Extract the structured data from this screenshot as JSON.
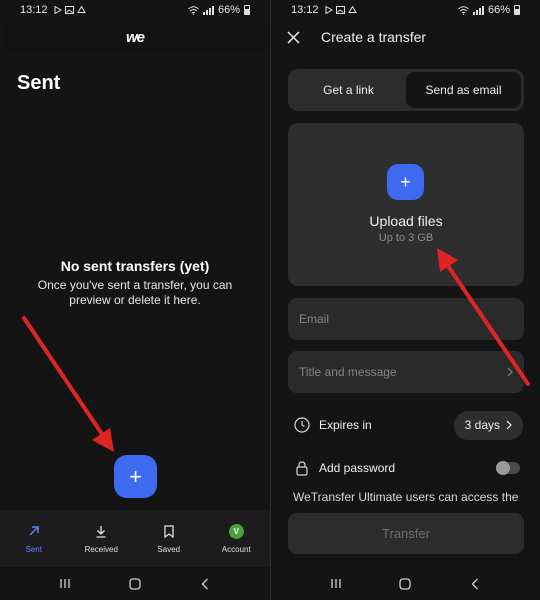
{
  "left": {
    "status": {
      "time": "13:12",
      "battery": "66%"
    },
    "logo": "we",
    "page_title": "Sent",
    "empty_title": "No sent transfers (yet)",
    "empty_desc": "Once you've sent a transfer, you can preview or delete it here.",
    "fab_label": "+",
    "nav": {
      "items": [
        {
          "label": "Sent",
          "icon": "send-arrow-icon"
        },
        {
          "label": "Received",
          "icon": "download-icon"
        },
        {
          "label": "Saved",
          "icon": "bookmark-icon"
        },
        {
          "label": "Account",
          "icon": "avatar"
        }
      ],
      "avatar_letter": "V",
      "active_color": "#5b86ff"
    }
  },
  "right": {
    "status": {
      "time": "13:12",
      "battery": "66%"
    },
    "header_title": "Create a transfer",
    "segments": [
      "Get a link",
      "Send as email"
    ],
    "selected_segment": "Send as email",
    "upload": {
      "plus": "+",
      "title": "Upload files",
      "subtitle": "Up to 3 GB"
    },
    "email_placeholder": "Email",
    "title_placeholder": "Title and message",
    "expires": {
      "label": "Expires in",
      "value": "3 days"
    },
    "password": {
      "label": "Add password",
      "enabled": false
    },
    "ultimate_text": "WeTransfer Ultimate users can access the",
    "transfer_button": "Transfer"
  },
  "colors": {
    "accent": "#3d6af0",
    "arrow": "#e02424",
    "background": "#141414"
  }
}
